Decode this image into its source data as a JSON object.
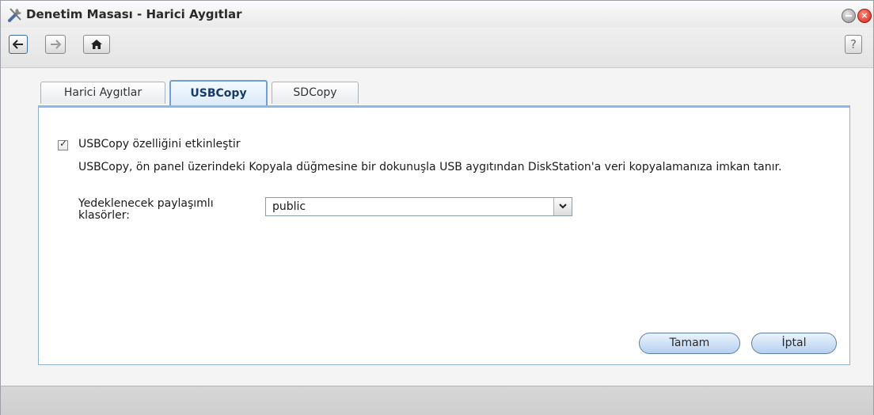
{
  "window": {
    "title": "Denetim Masası - Harici Aygıtlar"
  },
  "toolbar": {
    "help_label": "?"
  },
  "tabs": [
    {
      "label": "Harici Aygıtlar",
      "active": false
    },
    {
      "label": "USBCopy",
      "active": true
    },
    {
      "label": "SDCopy",
      "active": false
    }
  ],
  "usbcopy": {
    "enable_label": "USBCopy özelliğini etkinleştir",
    "enabled": true,
    "description": "USBCopy, ön panel üzerindeki Kopyala düğmesine bir dokunuşla USB aygıtından DiskStation'a veri kopyalamanıza imkan tanır.",
    "shared_folder_label": "Yedeklenecek paylaşımlı klasörler:",
    "shared_folder_value": "public"
  },
  "buttons": {
    "ok_label": "Tamam",
    "cancel_label": "İptal"
  },
  "colors": {
    "accent": "#6ea0d6",
    "panel_border": "#8fb0d0",
    "close": "#d2231a"
  }
}
